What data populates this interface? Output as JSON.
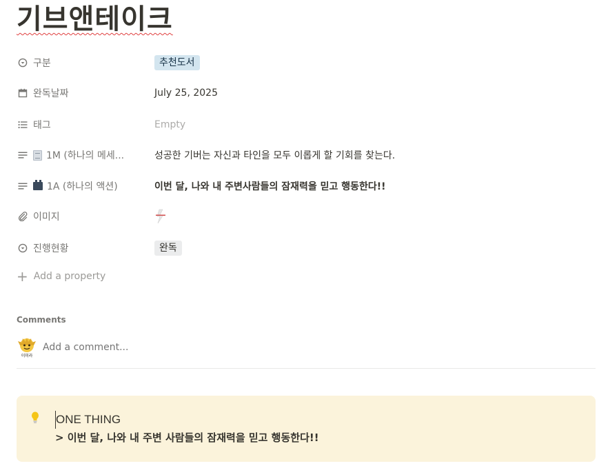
{
  "page": {
    "title": "기브앤테이크"
  },
  "properties": [
    {
      "key": "구분",
      "icon": "select-icon",
      "value": "추천도서",
      "type": "tag",
      "tag_color": "#d3e5ef"
    },
    {
      "key": "완독날짜",
      "icon": "calendar-icon",
      "value": "July 25, 2025",
      "type": "text"
    },
    {
      "key": "태그",
      "icon": "list-icon",
      "value": "Empty",
      "type": "empty"
    },
    {
      "key": "1M (하나의 메세...",
      "icon": "text-icon",
      "emoji": "page-emoji-icon",
      "value": "성공한 기버는 자신과 타인을 모두 이롭게 할 기회를 찾는다.",
      "type": "text"
    },
    {
      "key": "1A (하나의 액션)",
      "icon": "text-icon",
      "emoji": "clapper-emoji-icon",
      "value": "이번 달, 나와 내 주변사람들의 잠재력을 믿고 행동한다!!",
      "type": "bold"
    },
    {
      "key": "이미지",
      "icon": "attachment-icon",
      "value": "",
      "type": "image"
    },
    {
      "key": "진행현황",
      "icon": "status-icon",
      "value": "완독",
      "type": "tag",
      "tag_color": "#ebeced"
    }
  ],
  "add_property_label": "Add a property",
  "comments": {
    "label": "Comments",
    "placeholder": "Add a comment...",
    "avatar_text": "이미라"
  },
  "callout": {
    "icon": "lightbulb-icon",
    "title": "ONE THING",
    "body": "> 이번 달, 나와 내 주변 사람들의 잠재력을 믿고 행동한다!!",
    "bg": "#fbf3db"
  }
}
